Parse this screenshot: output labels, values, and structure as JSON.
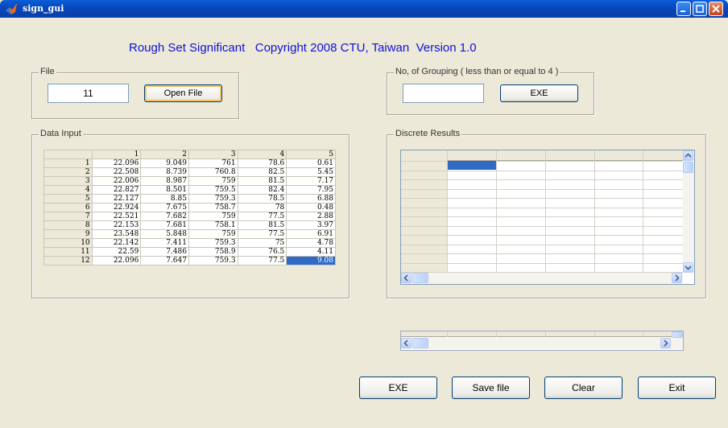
{
  "window": {
    "title": "sign_gui"
  },
  "header": {
    "text": "Rough Set Significant   Copyright 2008 CTU, Taiwan  Version 1.0"
  },
  "file_panel": {
    "title": "File",
    "value": "11",
    "open_label": "Open File"
  },
  "grouping_panel": {
    "title": "No, of Grouping ( less than or equal to 4 )",
    "value": "",
    "exe_label": "EXE"
  },
  "data_input": {
    "title": "Data Input",
    "columns": [
      "",
      "1",
      "2",
      "3",
      "4",
      "5"
    ],
    "rows": [
      [
        "1",
        "22.096",
        "9.049",
        "761",
        "78.6",
        "0.61"
      ],
      [
        "2",
        "22.508",
        "8.739",
        "760.8",
        "82.5",
        "5.45"
      ],
      [
        "3",
        "22.006",
        "8.987",
        "759",
        "81.5",
        "7.17"
      ],
      [
        "4",
        "22.827",
        "8.501",
        "759.5",
        "82.4",
        "7.95"
      ],
      [
        "5",
        "22.127",
        "8.85",
        "759.3",
        "78.5",
        "6.88"
      ],
      [
        "6",
        "22.924",
        "7.675",
        "758.7",
        "78",
        "0.48"
      ],
      [
        "7",
        "22.521",
        "7.682",
        "759",
        "77.5",
        "2.88"
      ],
      [
        "8",
        "22.153",
        "7.681",
        "758.1",
        "81.5",
        "3.97"
      ],
      [
        "9",
        "23.548",
        "5.848",
        "759",
        "77.5",
        "6.91"
      ],
      [
        "10",
        "22.142",
        "7.411",
        "759.3",
        "75",
        "4.78"
      ],
      [
        "11",
        "22.59",
        "7.486",
        "758.9",
        "76.5",
        "4.11"
      ],
      [
        "12",
        "22.096",
        "7.647",
        "759.3",
        "77.5",
        "9.08"
      ]
    ]
  },
  "discrete_results": {
    "title": "Discrete Results"
  },
  "bottom_buttons": {
    "exe": "EXE",
    "save": "Save file",
    "clear": "Clear",
    "exit": "Exit"
  },
  "colors": {
    "header_text": "#1010d8",
    "selection": "#316ac5",
    "titlebar": "#0a5fd8"
  }
}
